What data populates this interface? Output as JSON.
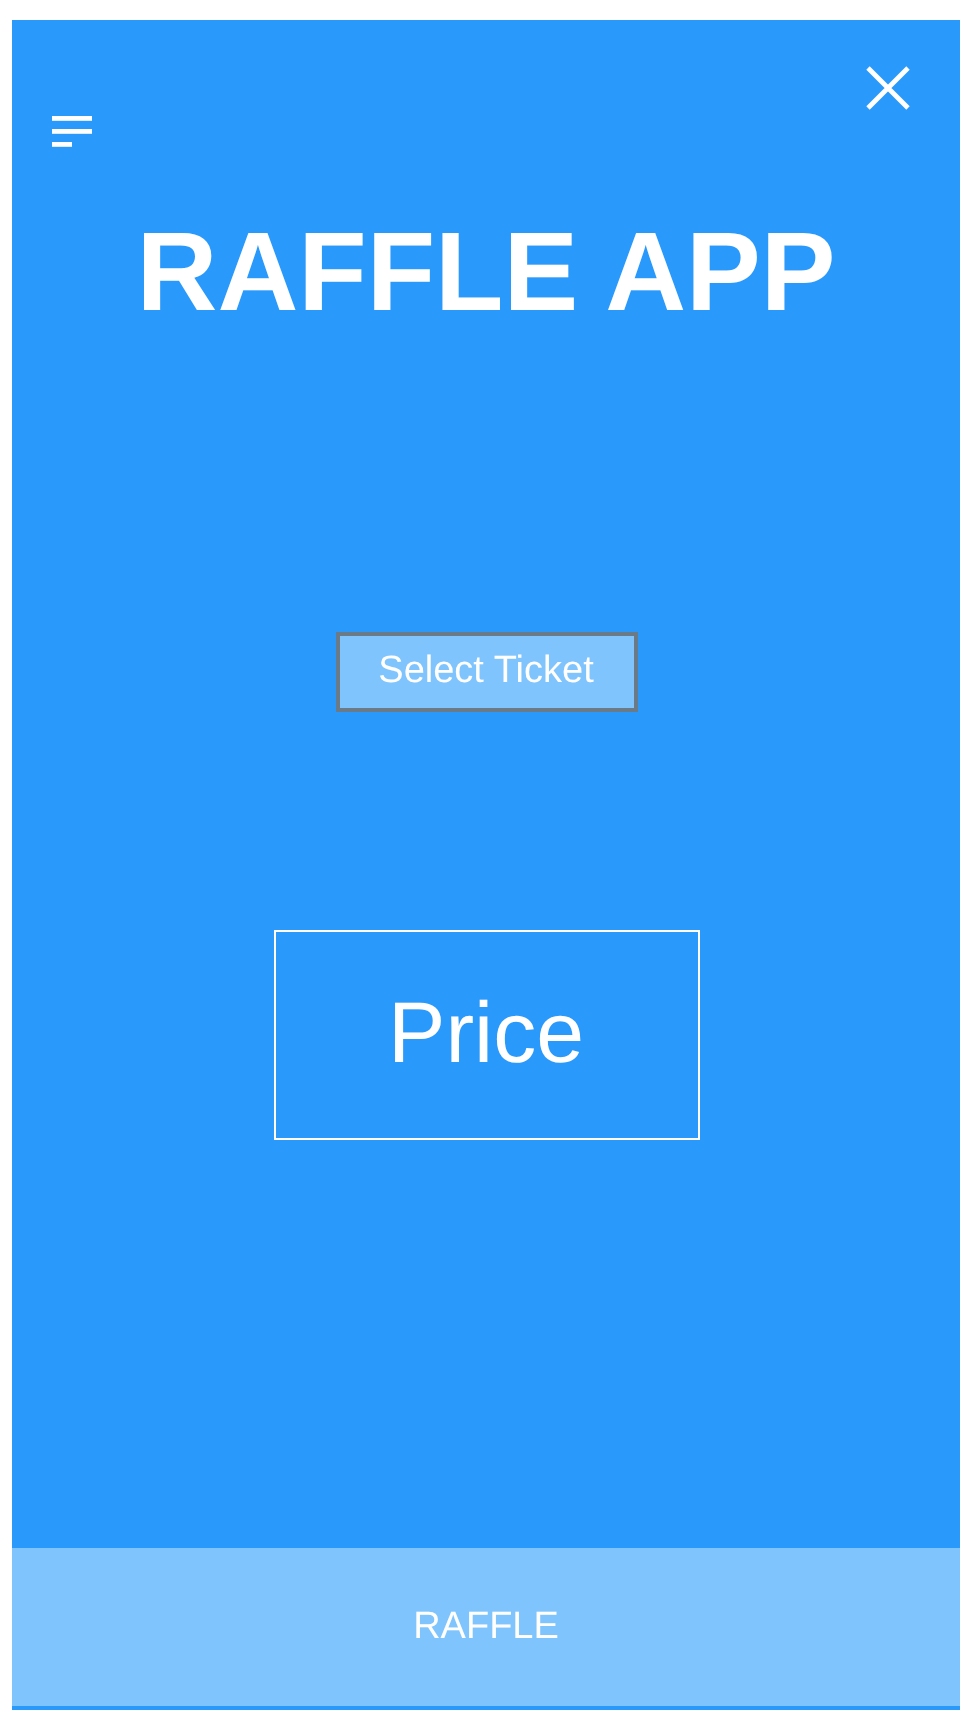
{
  "title": "RAFFLE APP",
  "select_button": {
    "label": "Select Ticket"
  },
  "price_box": {
    "label": "Price"
  },
  "bottom_button": {
    "label": "RAFFLE"
  }
}
